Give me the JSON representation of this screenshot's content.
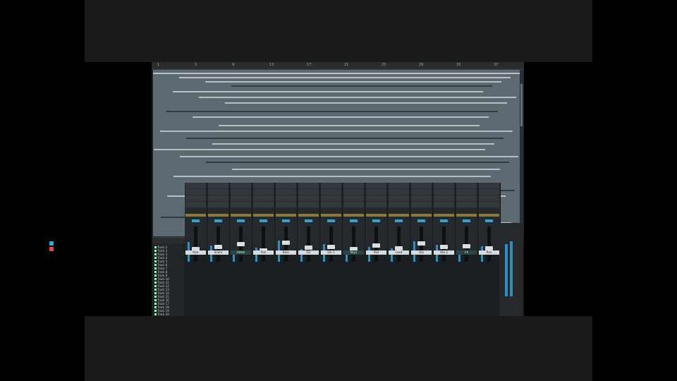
{
  "letterbox": {
    "color": "#1a1a1a"
  },
  "ruler": {
    "ticks": [
      "1",
      "5",
      "9",
      "13",
      "17",
      "21",
      "25",
      "29",
      "33",
      "37"
    ]
  },
  "arrange": {
    "background": "#5d6a71"
  },
  "status_bar": {
    "text": "",
    "controls": [
      "–",
      "+",
      "⤢"
    ]
  },
  "tracklist": {
    "items": [
      "Track 1",
      "Track 2",
      "Track 3",
      "Track 4",
      "Track 5",
      "Track 6",
      "Track 7",
      "Track 8",
      "Track 9",
      "Track 10",
      "Track 11",
      "Track 12",
      "Track 13",
      "Track 14",
      "Track 15",
      "Track 16",
      "Track 17",
      "Track 18",
      "Track 19",
      "Track 20"
    ]
  },
  "mixer": {
    "strips": [
      {
        "name": "Kick",
        "level": 0.35,
        "meter": 0.55
      },
      {
        "name": "Snare",
        "level": 0.4,
        "meter": 0.45
      },
      {
        "name": "HiHat",
        "level": 0.5,
        "meter": 0.3
      },
      {
        "name": "Tom",
        "level": 0.3,
        "meter": 0.4
      },
      {
        "name": "Bass",
        "level": 0.55,
        "meter": 0.6
      },
      {
        "name": "Gtr",
        "level": 0.38,
        "meter": 0.35
      },
      {
        "name": "Gtr 2",
        "level": 0.42,
        "meter": 0.5
      },
      {
        "name": "Keys",
        "level": 0.33,
        "meter": 0.25
      },
      {
        "name": "Pad",
        "level": 0.45,
        "meter": 0.42
      },
      {
        "name": "Lead",
        "level": 0.36,
        "meter": 0.38
      },
      {
        "name": "Vox",
        "level": 0.52,
        "meter": 0.58
      },
      {
        "name": "Vox 2",
        "level": 0.4,
        "meter": 0.48
      },
      {
        "name": "FX",
        "level": 0.44,
        "meter": 0.3
      },
      {
        "name": "Rev",
        "level": 0.37,
        "meter": 0.44
      }
    ],
    "master": {
      "level": 0.75
    }
  },
  "colors": {
    "meter": "#2f8fc0",
    "mute": "#3aa5d8",
    "solo": "#e04848",
    "insert": "#8a7a3a"
  }
}
